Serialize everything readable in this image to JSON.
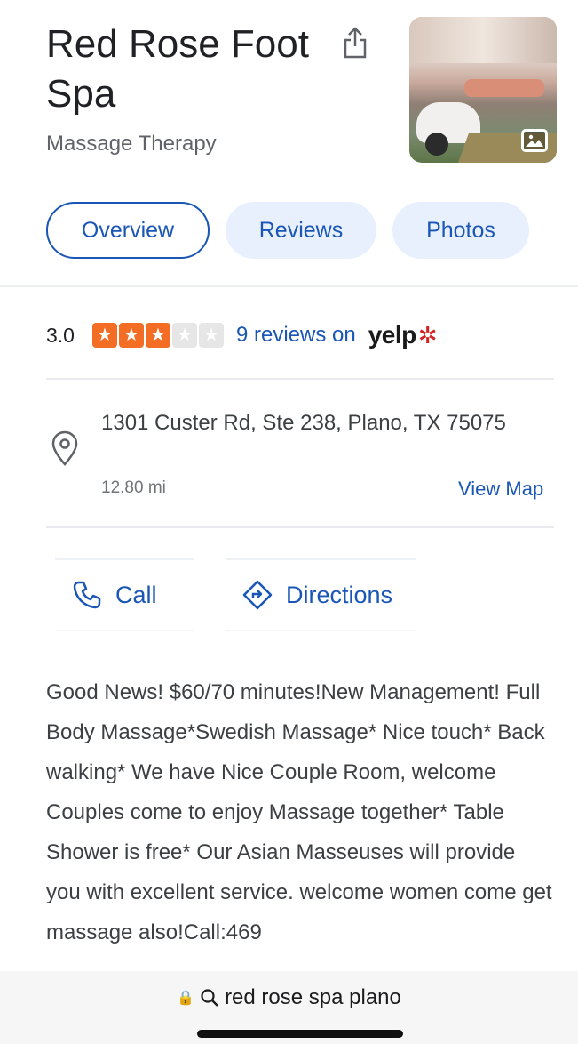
{
  "business": {
    "name": "Red Rose Foot Spa",
    "category": "Massage Therapy"
  },
  "tabs": [
    {
      "label": "Overview",
      "active": true
    },
    {
      "label": "Reviews",
      "active": false
    },
    {
      "label": "Photos",
      "active": false
    }
  ],
  "rating": {
    "value": "3.0",
    "stars_filled": 3,
    "stars_total": 5,
    "reviews_text": "9 reviews on",
    "source": "yelp"
  },
  "address": {
    "line": "1301 Custer Rd, Ste 238, Plano, TX 75075",
    "distance": "12.80 mi",
    "view_map_label": "View Map"
  },
  "actions": {
    "call_label": "Call",
    "directions_label": "Directions"
  },
  "description": "Good News! $60/70 minutes!New Management! Full Body Massage*Swedish Massage* Nice touch* Back walking* We have Nice Couple Room, welcome Couples come to enjoy Massage together* Table Shower is free* Our Asian Masseuses will provide you with excellent service. welcome women come get massage also!Call:469",
  "browser": {
    "url_query": "red rose spa plano"
  },
  "colors": {
    "link": "#1a56b6",
    "yelp_star": "#f36d25",
    "yelp_red": "#d32323",
    "tab_bg": "#e8f0fe"
  },
  "icons": [
    "share-icon",
    "gallery-icon",
    "pin-icon",
    "phone-icon",
    "directions-icon",
    "lock-icon",
    "search-icon"
  ]
}
